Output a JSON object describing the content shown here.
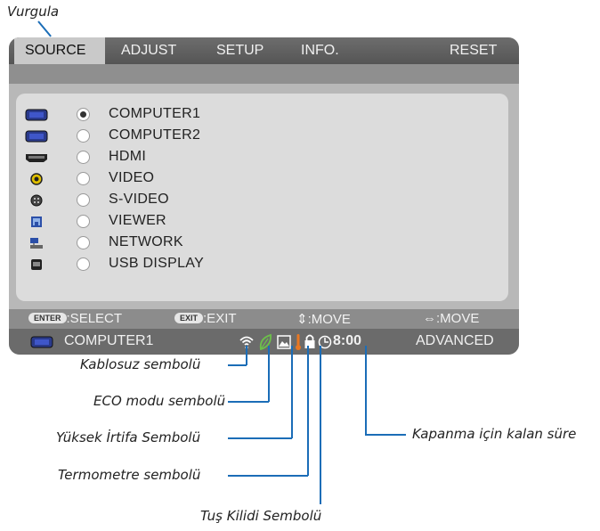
{
  "callouts": {
    "highlight": "Vurgula",
    "wireless": "Kablosuz sembolü",
    "eco": "ECO modu sembolü",
    "altitude": "Yüksek İrtifa Sembolü",
    "thermometer": "Termometre sembolü",
    "key_lock": "Tuş Kilidi Sembolü",
    "off_timer": "Kapanma için kalan süre"
  },
  "menu": {
    "tabs": [
      {
        "label": "SOURCE",
        "active": true
      },
      {
        "label": "ADJUST",
        "active": false
      },
      {
        "label": "SETUP",
        "active": false
      },
      {
        "label": "INFO.",
        "active": false
      }
    ],
    "reset_label": "RESET"
  },
  "sources": [
    {
      "label": "COMPUTER1",
      "icon": "vga-port-icon",
      "selected": true
    },
    {
      "label": "COMPUTER2",
      "icon": "vga-port-icon",
      "selected": false
    },
    {
      "label": "HDMI",
      "icon": "hdmi-port-icon",
      "selected": false
    },
    {
      "label": "VIDEO",
      "icon": "rca-video-icon",
      "selected": false
    },
    {
      "label": "S-VIDEO",
      "icon": "svideo-port-icon",
      "selected": false
    },
    {
      "label": "VIEWER",
      "icon": "viewer-icon",
      "selected": false
    },
    {
      "label": "NETWORK",
      "icon": "network-icon",
      "selected": false
    },
    {
      "label": "USB DISPLAY",
      "icon": "usb-display-icon",
      "selected": false
    }
  ],
  "help": {
    "enter_key": "ENTER",
    "enter_text": ":SELECT",
    "exit_key": "EXIT",
    "exit_text": ":EXIT",
    "move_v": "⇕:MOVE",
    "move_h": "⇔:MOVE"
  },
  "status": {
    "source": "COMPUTER1",
    "timer": "8:00",
    "mode": "ADVANCED"
  },
  "colors": {
    "callout_line": "#1b6db7",
    "eco_green": "#6cc04a",
    "thermometer_orange": "#e87722"
  }
}
